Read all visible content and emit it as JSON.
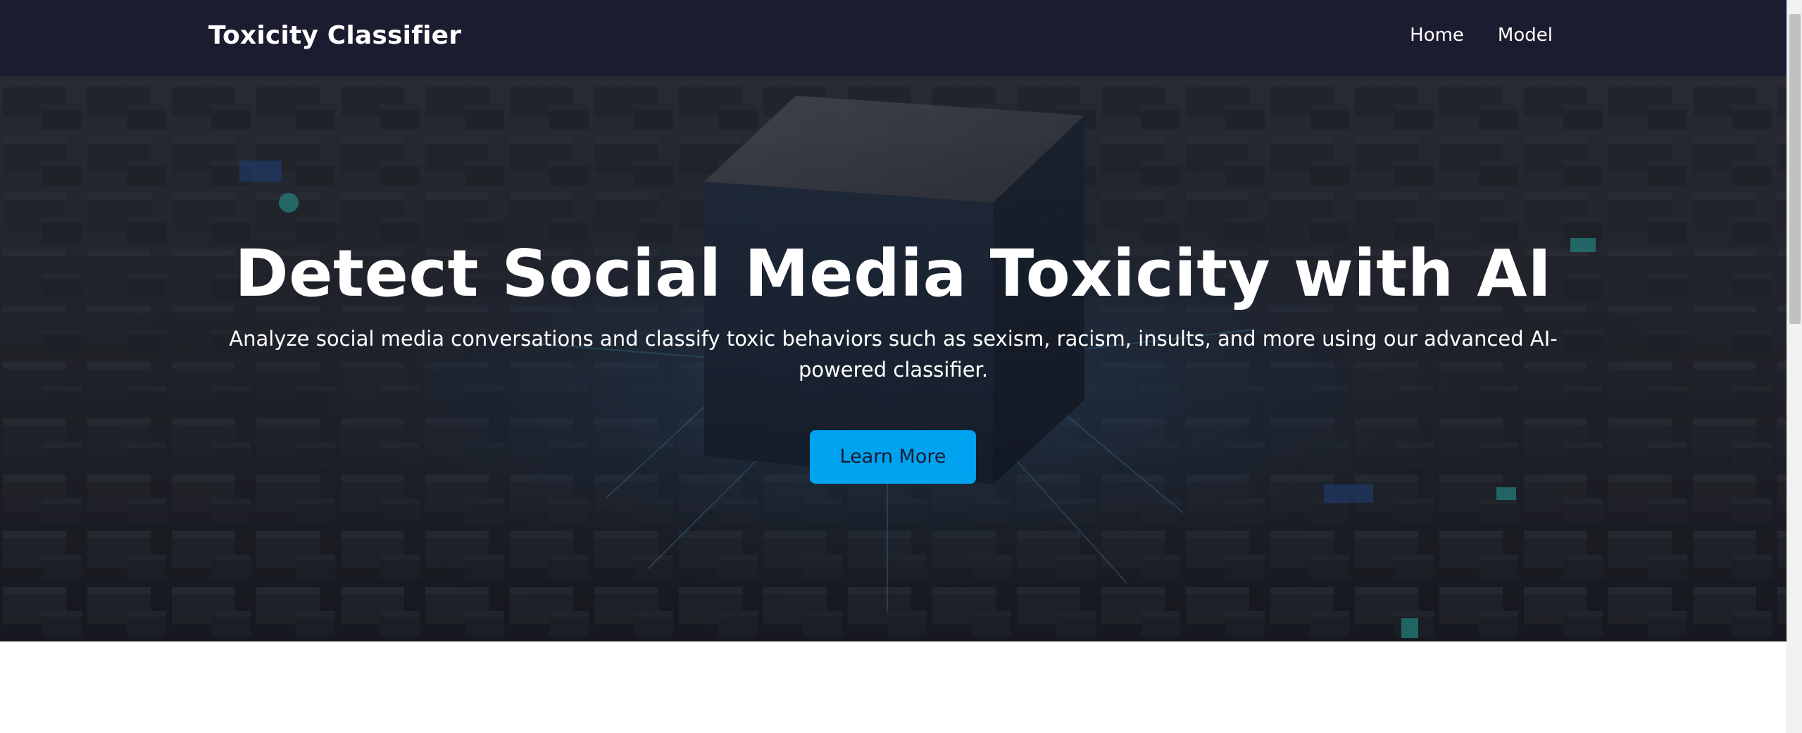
{
  "navbar": {
    "brand": "Toxicity Classifier",
    "links": [
      {
        "label": "Home"
      },
      {
        "label": "Model"
      }
    ],
    "background_color": "#1c1c30"
  },
  "hero": {
    "title": "Detect Social Media Toxicity with AI",
    "subtitle": "Analyze social media conversations and classify toxic behaviors such as sexism, racism, insults, and more using our advanced AI-powered classifier.",
    "button_label": "Learn More",
    "button_color": "#00a3f0",
    "background_description_icon": "ai-cube-circuit-image"
  },
  "scrollbar": {
    "position_fraction": 0.0
  }
}
